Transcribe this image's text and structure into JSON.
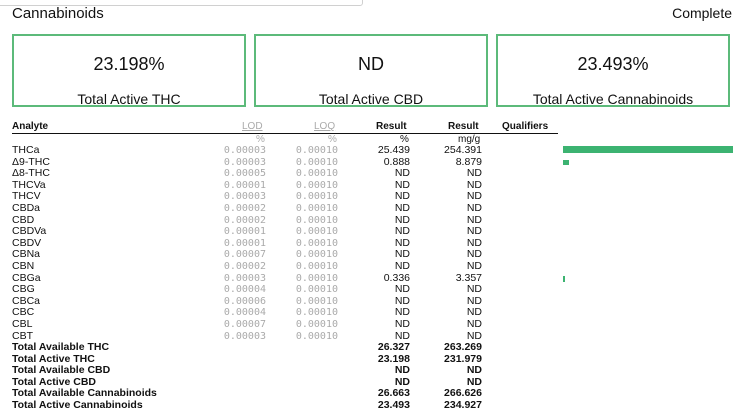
{
  "section": {
    "title": "Cannabinoids",
    "status": "Complete"
  },
  "summary": [
    {
      "value": "23.198%",
      "label": "Total Active THC"
    },
    {
      "value": "ND",
      "label": "Total Active CBD"
    },
    {
      "value": "23.493%",
      "label": "Total Active Cannabinoids"
    }
  ],
  "table": {
    "headers": {
      "analyte": "Analyte",
      "lod": "LOD",
      "loq": "LOQ",
      "result1": "Result",
      "result2": "Result",
      "qualifiers": "Qualifiers"
    },
    "units": {
      "lod": "%",
      "loq": "%",
      "result1": "%",
      "result2": "mg/g"
    },
    "bar_max_percent": 25.439,
    "accent_color": "#3cb371",
    "rows": [
      {
        "analyte": "THCa",
        "lod": "0.00003",
        "loq": "0.00010",
        "pct": "25.439",
        "mg": "254.391",
        "bar": 25.439
      },
      {
        "analyte": "Δ9-THC",
        "lod": "0.00003",
        "loq": "0.00010",
        "pct": "0.888",
        "mg": "8.879",
        "bar": 0.888
      },
      {
        "analyte": "Δ8-THC",
        "lod": "0.00005",
        "loq": "0.00010",
        "pct": "ND",
        "mg": "ND"
      },
      {
        "analyte": "THCVa",
        "lod": "0.00001",
        "loq": "0.00010",
        "pct": "ND",
        "mg": "ND"
      },
      {
        "analyte": "THCV",
        "lod": "0.00003",
        "loq": "0.00010",
        "pct": "ND",
        "mg": "ND"
      },
      {
        "analyte": "CBDa",
        "lod": "0.00002",
        "loq": "0.00010",
        "pct": "ND",
        "mg": "ND"
      },
      {
        "analyte": "CBD",
        "lod": "0.00002",
        "loq": "0.00010",
        "pct": "ND",
        "mg": "ND"
      },
      {
        "analyte": "CBDVa",
        "lod": "0.00001",
        "loq": "0.00010",
        "pct": "ND",
        "mg": "ND"
      },
      {
        "analyte": "CBDV",
        "lod": "0.00001",
        "loq": "0.00010",
        "pct": "ND",
        "mg": "ND"
      },
      {
        "analyte": "CBNa",
        "lod": "0.00007",
        "loq": "0.00010",
        "pct": "ND",
        "mg": "ND"
      },
      {
        "analyte": "CBN",
        "lod": "0.00002",
        "loq": "0.00010",
        "pct": "ND",
        "mg": "ND"
      },
      {
        "analyte": "CBGa",
        "lod": "0.00003",
        "loq": "0.00010",
        "pct": "0.336",
        "mg": "3.357",
        "bar": 0.336
      },
      {
        "analyte": "CBG",
        "lod": "0.00004",
        "loq": "0.00010",
        "pct": "ND",
        "mg": "ND"
      },
      {
        "analyte": "CBCa",
        "lod": "0.00006",
        "loq": "0.00010",
        "pct": "ND",
        "mg": "ND"
      },
      {
        "analyte": "CBC",
        "lod": "0.00004",
        "loq": "0.00010",
        "pct": "ND",
        "mg": "ND"
      },
      {
        "analyte": "CBL",
        "lod": "0.00007",
        "loq": "0.00010",
        "pct": "ND",
        "mg": "ND"
      },
      {
        "analyte": "CBT",
        "lod": "0.00003",
        "loq": "0.00010",
        "pct": "ND",
        "mg": "ND"
      },
      {
        "analyte": "Total Available THC",
        "pct": "26.327",
        "mg": "263.269",
        "bold": true
      },
      {
        "analyte": "Total Active THC",
        "pct": "23.198",
        "mg": "231.979",
        "bold": true
      },
      {
        "analyte": "Total Available CBD",
        "pct": "ND",
        "mg": "ND",
        "bold": true
      },
      {
        "analyte": "Total Active CBD",
        "pct": "ND",
        "mg": "ND",
        "bold": true
      },
      {
        "analyte": "Total Available Cannabinoids",
        "pct": "26.663",
        "mg": "266.626",
        "bold": true
      },
      {
        "analyte": "Total Active Cannabinoids",
        "pct": "23.493",
        "mg": "234.927",
        "bold": true
      }
    ]
  }
}
